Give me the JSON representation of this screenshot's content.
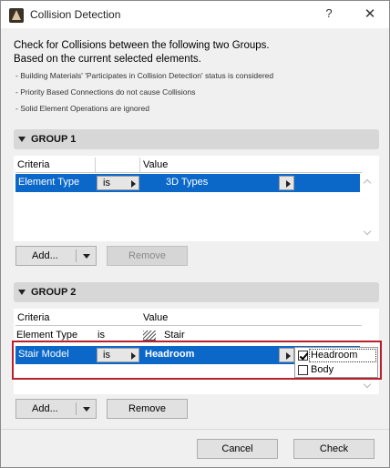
{
  "window": {
    "title": "Collision Detection",
    "help": "?",
    "close": "✕"
  },
  "intro": {
    "line1": "Check for Collisions between the following two Groups.",
    "line2": "Based on the current selected elements.",
    "notes": [
      "- Building Materials' 'Participates in Collision Detection' status is considered",
      "- Priority Based Connections do not cause Collisions",
      "- Solid Element Operations are ignored"
    ]
  },
  "group1": {
    "title": "GROUP 1",
    "col_criteria": "Criteria",
    "col_value": "Value",
    "rows": [
      {
        "criteria": "Element Type",
        "operator": "is",
        "value": "3D Types",
        "selected": true
      }
    ],
    "add_label": "Add...",
    "remove_label": "Remove"
  },
  "group2": {
    "title": "GROUP 2",
    "col_criteria": "Criteria",
    "col_value": "Value",
    "rows": [
      {
        "criteria": "Element Type",
        "operator": "is",
        "value": "Stair",
        "selected": false
      },
      {
        "criteria": "Stair Model",
        "operator": "is",
        "value": "Headroom",
        "selected": true
      }
    ],
    "popup": [
      {
        "label": "Headroom",
        "checked": true
      },
      {
        "label": "Body",
        "checked": false
      }
    ],
    "add_label": "Add...",
    "remove_label": "Remove"
  },
  "footer": {
    "cancel_label": "Cancel",
    "check_label": "Check"
  },
  "colors": {
    "selection": "#0b68c8",
    "highlight_border": "#b8202e",
    "group_header": "#d7d7d7"
  }
}
